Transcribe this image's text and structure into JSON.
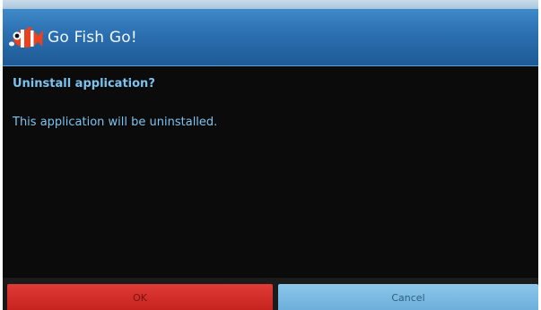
{
  "header": {
    "title": "Go Fish Go!",
    "icon": "clownfish-icon"
  },
  "dialog": {
    "heading": "Uninstall application?",
    "message": "This application will be uninstalled."
  },
  "buttons": {
    "ok_label": "OK",
    "cancel_label": "Cancel"
  },
  "colors": {
    "accent_text": "#7dc3f0",
    "ok_button": "#d42d28",
    "cancel_button": "#7bbce4",
    "title_bar": "#2b6fb0",
    "background": "#0b0b0b"
  }
}
